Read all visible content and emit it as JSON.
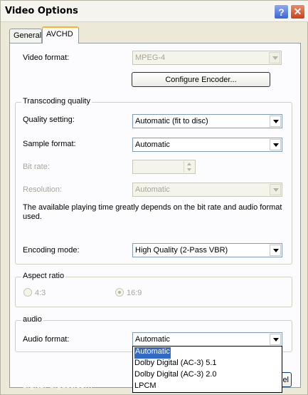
{
  "window": {
    "title": "Video Options"
  },
  "tabs": [
    {
      "label": "General"
    },
    {
      "label": "AVCHD"
    }
  ],
  "video": {
    "format_label": "Video format:",
    "format_value": "MPEG-4",
    "configure_button": "Configure Encoder..."
  },
  "transcoding": {
    "group_title": "Transcoding quality",
    "quality_label": "Quality setting:",
    "quality_value": "Automatic (fit to disc)",
    "sample_label": "Sample format:",
    "sample_value": "Automatic",
    "bitrate_label": "Bit rate:",
    "bitrate_value": "",
    "resolution_label": "Resolution:",
    "resolution_value": "Automatic",
    "note": "The available playing time greatly depends on the bit rate and audio format used.",
    "encoding_label": "Encoding mode:",
    "encoding_value": "High Quality (2-Pass VBR)"
  },
  "aspect": {
    "group_title": "Aspect ratio",
    "option_43": "4:3",
    "option_169": "16:9",
    "selected": "16:9"
  },
  "audio": {
    "group_title": "audio",
    "format_label": "Audio format:",
    "format_value": "Automatic",
    "options": [
      "Automatic",
      "Dolby Digital (AC-3) 5.1",
      "Dolby Digital (AC-3) 2.0",
      "LPCM"
    ]
  },
  "footer": {
    "watermark": "digital-digest.com",
    "cancel_fragment": "el"
  },
  "colors": {
    "selection": "#316ac5",
    "tab_highlight": "#f8b52c"
  }
}
